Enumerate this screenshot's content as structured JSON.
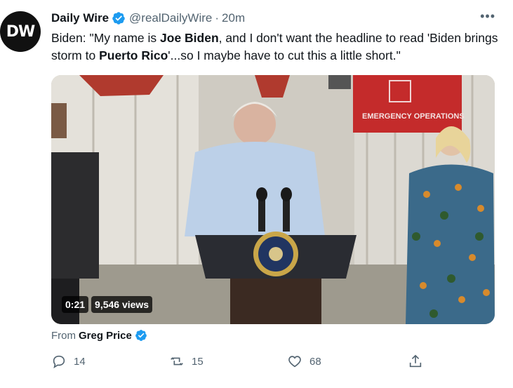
{
  "account": {
    "avatar_text": "DW",
    "name": "Daily Wire",
    "handle": "@realDailyWire",
    "separator": "·",
    "time": "20m"
  },
  "tweet": {
    "part1": "Biden: \"My name is ",
    "bold1": "Joe Biden",
    "part2": ", and I don't want the headline to read 'Biden brings storm to ",
    "bold2": "Puerto Rico",
    "part3": "'...so I maybe have to cut this a little short.\""
  },
  "video": {
    "duration": "0:21",
    "views": "9,546 views",
    "sign_text": "EMERGENCY OPERATIONS"
  },
  "attribution": {
    "prefix": "From",
    "source_name": "Greg Price"
  },
  "actions": {
    "replies": "14",
    "retweets": "15",
    "likes": "68"
  },
  "colors": {
    "verified": "#1d9bf0",
    "muted": "#536471"
  }
}
